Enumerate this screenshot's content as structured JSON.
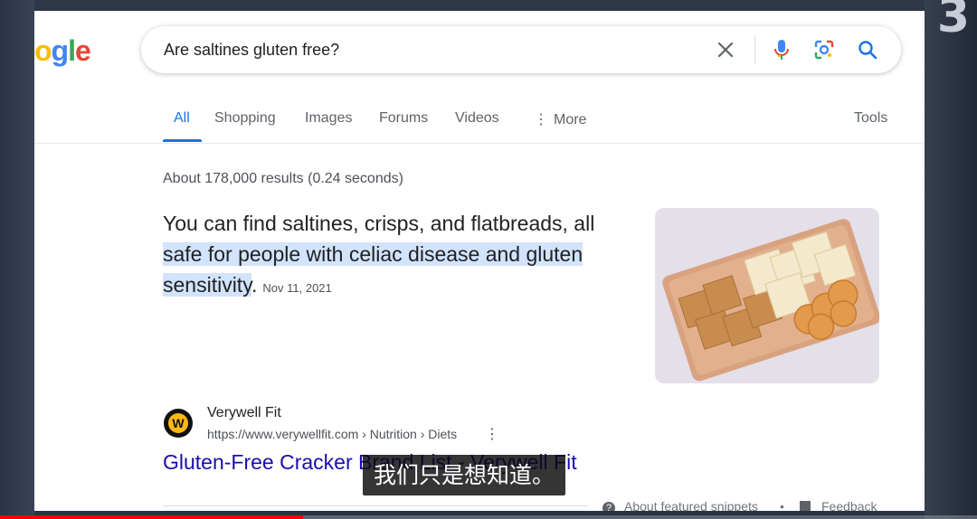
{
  "search": {
    "logo_text": "ogle",
    "query": "Are saltines gluten free?"
  },
  "tabs": [
    {
      "label": "All",
      "active": true
    },
    {
      "label": "Shopping"
    },
    {
      "label": "Images"
    },
    {
      "label": "Forums"
    },
    {
      "label": "Videos"
    },
    {
      "label": "More"
    }
  ],
  "tools_label": "Tools",
  "stats": "About 178,000 results (0.24 seconds)",
  "snippet": {
    "text_plain": "You can find saltines, crisps, and flatbreads, all ",
    "text_highlight": "safe for people with celiac disease and gluten sensitivity",
    "text_end": ".",
    "date": "Nov 11, 2021"
  },
  "result": {
    "site_name": "Verywell Fit",
    "url": "https://www.verywellfit.com › Nutrition › Diets",
    "title": "Gluten-Free Cracker Brand List - Verywell Fit"
  },
  "footer": {
    "about": "About featured snippets",
    "separator": "•",
    "feedback": "Feedback"
  },
  "overlay": {
    "subtitle": "我们只是想知道。",
    "corner_digit": "3"
  },
  "video_progress": 0.31,
  "colors": {
    "accent": "#1a73e8",
    "link": "#1a0dab",
    "highlight": "#d2e3fc"
  }
}
